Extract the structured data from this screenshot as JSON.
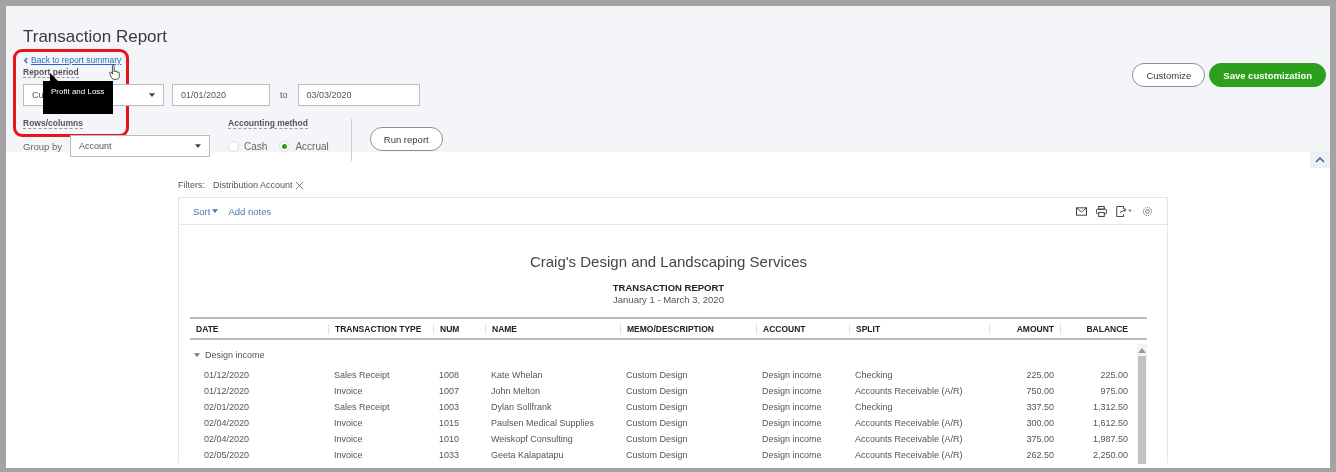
{
  "title": "Transaction Report",
  "back_link": "Back to report summary",
  "report_period": {
    "label": "Report period",
    "value": "Cu",
    "from": "01/01/2020",
    "to_label": "to",
    "to": "03/03/2020"
  },
  "tooltip": "Profit and Loss",
  "rows_columns": {
    "label": "Rows/columns",
    "group_by_label": "Group by",
    "group_by": "Account"
  },
  "accounting_method": {
    "label": "Accounting method",
    "options": [
      {
        "label": "Cash",
        "selected": false
      },
      {
        "label": "Accrual",
        "selected": true
      }
    ]
  },
  "run_button": "Run report",
  "buttons": [
    {
      "label": "Customize",
      "kind": "outline"
    },
    {
      "label": "Save customization",
      "kind": "primary"
    }
  ],
  "filters": {
    "label": "Filters:",
    "items": [
      "Distribution Account"
    ]
  },
  "toolbar": {
    "sort": "Sort",
    "notes": "Add notes"
  },
  "report": {
    "company": "Craig's Design and Landscaping Services",
    "title": "TRANSACTION REPORT",
    "period": "January 1 - March 3, 2020"
  },
  "table": {
    "columns": [
      "DATE",
      "TRANSACTION TYPE",
      "NUM",
      "NAME",
      "MEMO/DESCRIPTION",
      "ACCOUNT",
      "SPLIT",
      "AMOUNT",
      "BALANCE"
    ],
    "group": {
      "label": "Design income",
      "expanded": true
    },
    "rows": [
      [
        "01/12/2020",
        "Sales Receipt",
        "1008",
        "Kate Whelan",
        "Custom Design",
        "Design income",
        "Checking",
        "225.00",
        "225.00"
      ],
      [
        "01/12/2020",
        "Invoice",
        "1007",
        "John Melton",
        "Custom Design",
        "Design income",
        "Accounts Receivable (A/R)",
        "750.00",
        "975.00"
      ],
      [
        "02/01/2020",
        "Sales Receipt",
        "1003",
        "Dylan Sollfrank",
        "Custom Design",
        "Design income",
        "Checking",
        "337.50",
        "1,312.50"
      ],
      [
        "02/04/2020",
        "Invoice",
        "1015",
        "Paulsen Medical Supplies",
        "Custom Design",
        "Design income",
        "Accounts Receivable (A/R)",
        "300.00",
        "1,612.50"
      ],
      [
        "02/04/2020",
        "Invoice",
        "1010",
        "Weiskopf Consulting",
        "Custom Design",
        "Design income",
        "Accounts Receivable (A/R)",
        "375.00",
        "1,987.50"
      ],
      [
        "02/05/2020",
        "Invoice",
        "1033",
        "Geeta Kalapatapu",
        "Custom Design",
        "Design income",
        "Accounts Receivable (A/R)",
        "262.50",
        "2,250.00"
      ]
    ]
  }
}
